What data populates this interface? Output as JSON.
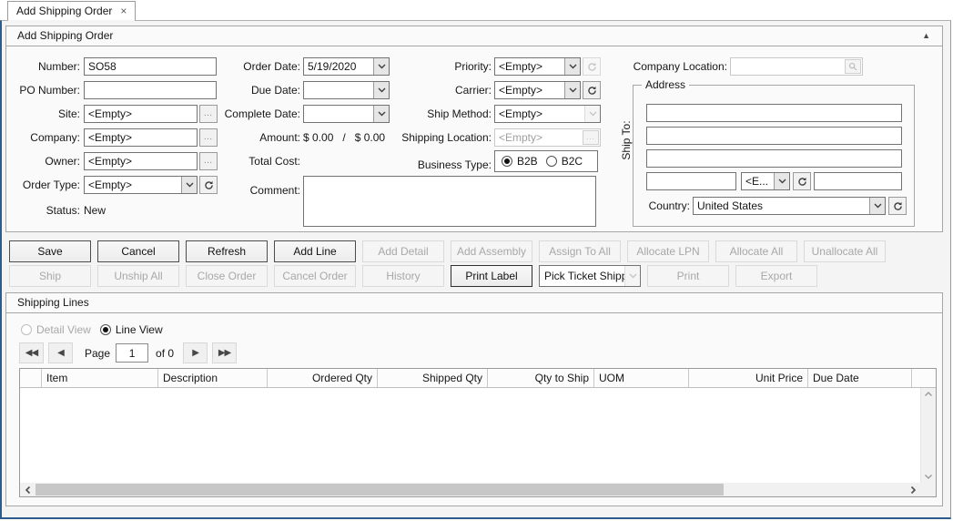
{
  "tab": {
    "title": "Add Shipping Order"
  },
  "icons": {
    "close": "×",
    "collapse": "▲",
    "ellipsis": "…",
    "first": "◀◀",
    "prev": "◀",
    "next": "▶",
    "last": "▶▶"
  },
  "order_panel": {
    "title": "Add Shipping Order",
    "number_label": "Number:",
    "number_value": "SO58",
    "po_label": "PO Number:",
    "po_value": "",
    "site_label": "Site:",
    "site_value": "<Empty>",
    "company_label": "Company:",
    "company_value": "<Empty>",
    "owner_label": "Owner:",
    "owner_value": "<Empty>",
    "order_type_label": "Order Type:",
    "order_type_value": "<Empty>",
    "status_label": "Status:",
    "status_value": "New",
    "order_date_label": "Order Date:",
    "order_date_value": "5/19/2020",
    "due_date_label": "Due Date:",
    "due_date_value": "",
    "complete_date_label": "Complete Date:",
    "complete_date_value": "",
    "amount_label": "Amount:",
    "amount_value": "$ 0.00   /   $ 0.00",
    "total_cost_label": "Total Cost:",
    "total_cost_value": "",
    "comment_label": "Comment:",
    "comment_value": "",
    "priority_label": "Priority:",
    "priority_value": "<Empty>",
    "carrier_label": "Carrier:",
    "carrier_value": "<Empty>",
    "ship_method_label": "Ship Method:",
    "ship_method_value": "<Empty>",
    "shipping_location_label": "Shipping Location:",
    "shipping_location_value": "<Empty>",
    "business_type_label": "Business Type:",
    "b2b_label": "B2B",
    "b2c_label": "B2C"
  },
  "ship_to": {
    "side_label": "Ship To:",
    "company_location_label": "Company Location:",
    "company_location_value": "",
    "address_title": "Address",
    "line1": "",
    "line2": "",
    "line3": "",
    "city_value": "",
    "state_value": "<E...",
    "postal_value": "",
    "country_label": "Country:",
    "country_value": "United States"
  },
  "toolbar": {
    "row1": [
      {
        "label": "Save"
      },
      {
        "label": "Cancel"
      },
      {
        "label": "Refresh"
      },
      {
        "label": "Add Line"
      },
      {
        "label": "Add Detail"
      },
      {
        "label": "Add Assembly"
      },
      {
        "label": "Assign To All"
      },
      {
        "label": "Allocate LPN"
      },
      {
        "label": "Allocate All"
      },
      {
        "label": "Unallocate All"
      }
    ],
    "row2": [
      {
        "label": "Ship"
      },
      {
        "label": "Unship All"
      },
      {
        "label": "Close Order"
      },
      {
        "label": "Cancel Order"
      },
      {
        "label": "History"
      },
      {
        "label": "Print Label"
      }
    ],
    "print_combo_value": "Pick Ticket Shipp...",
    "print_label": "Print",
    "export_label": "Export"
  },
  "lines_panel": {
    "title": "Shipping Lines",
    "detail_view_label": "Detail View",
    "line_view_label": "Line View",
    "pager": {
      "page_label": "Page",
      "page_value": "1",
      "of_label": "of 0"
    },
    "grid": {
      "columns": [
        "",
        "Item",
        "Description",
        "Ordered Qty",
        "Shipped Qty",
        "Qty to Ship",
        "UOM",
        "Unit Price",
        "Due Date"
      ],
      "rows": []
    }
  }
}
